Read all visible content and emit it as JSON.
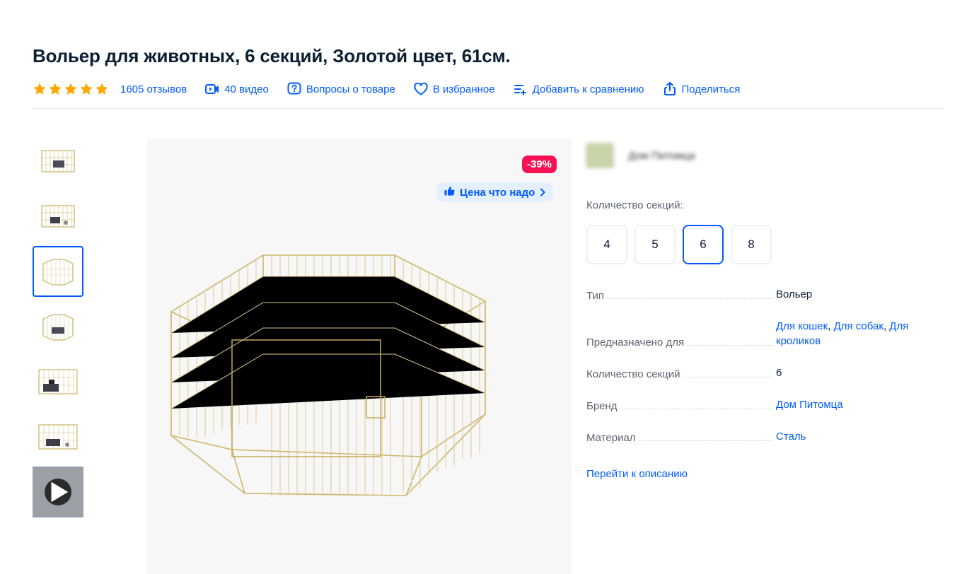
{
  "title": "Вольер для животных, 6 секций, Золотой цвет, 61см.",
  "meta": {
    "rating_stars": 5,
    "reviews": "1605 отзывов",
    "videos": "40 видео",
    "questions": "Вопросы о товаре",
    "favorite": "В избранное",
    "compare": "Добавить к сравнению",
    "share": "Поделиться"
  },
  "badges": {
    "discount": "-39%",
    "price_tag": "Цена что надо"
  },
  "seller": {
    "name": "Дом Питомца"
  },
  "sections": {
    "label": "Количество секций:",
    "options": [
      "4",
      "5",
      "6",
      "8"
    ],
    "selected": "6"
  },
  "specs": {
    "type_key": "Тип",
    "type_val": "Вольер",
    "for_key": "Предназначено для",
    "for_cats": "Для кошек",
    "for_dogs": "Для собак",
    "for_rabbits": "Для кроликов",
    "count_key": "Количество секций",
    "count_val": "6",
    "brand_key": "Бренд",
    "brand_val": "Дом Питомца",
    "material_key": "Материал",
    "material_val": "Сталь"
  },
  "goto_description": "Перейти к описанию",
  "colors": {
    "accent": "#005bff",
    "discount": "#f91155",
    "star": "#ffa800"
  }
}
